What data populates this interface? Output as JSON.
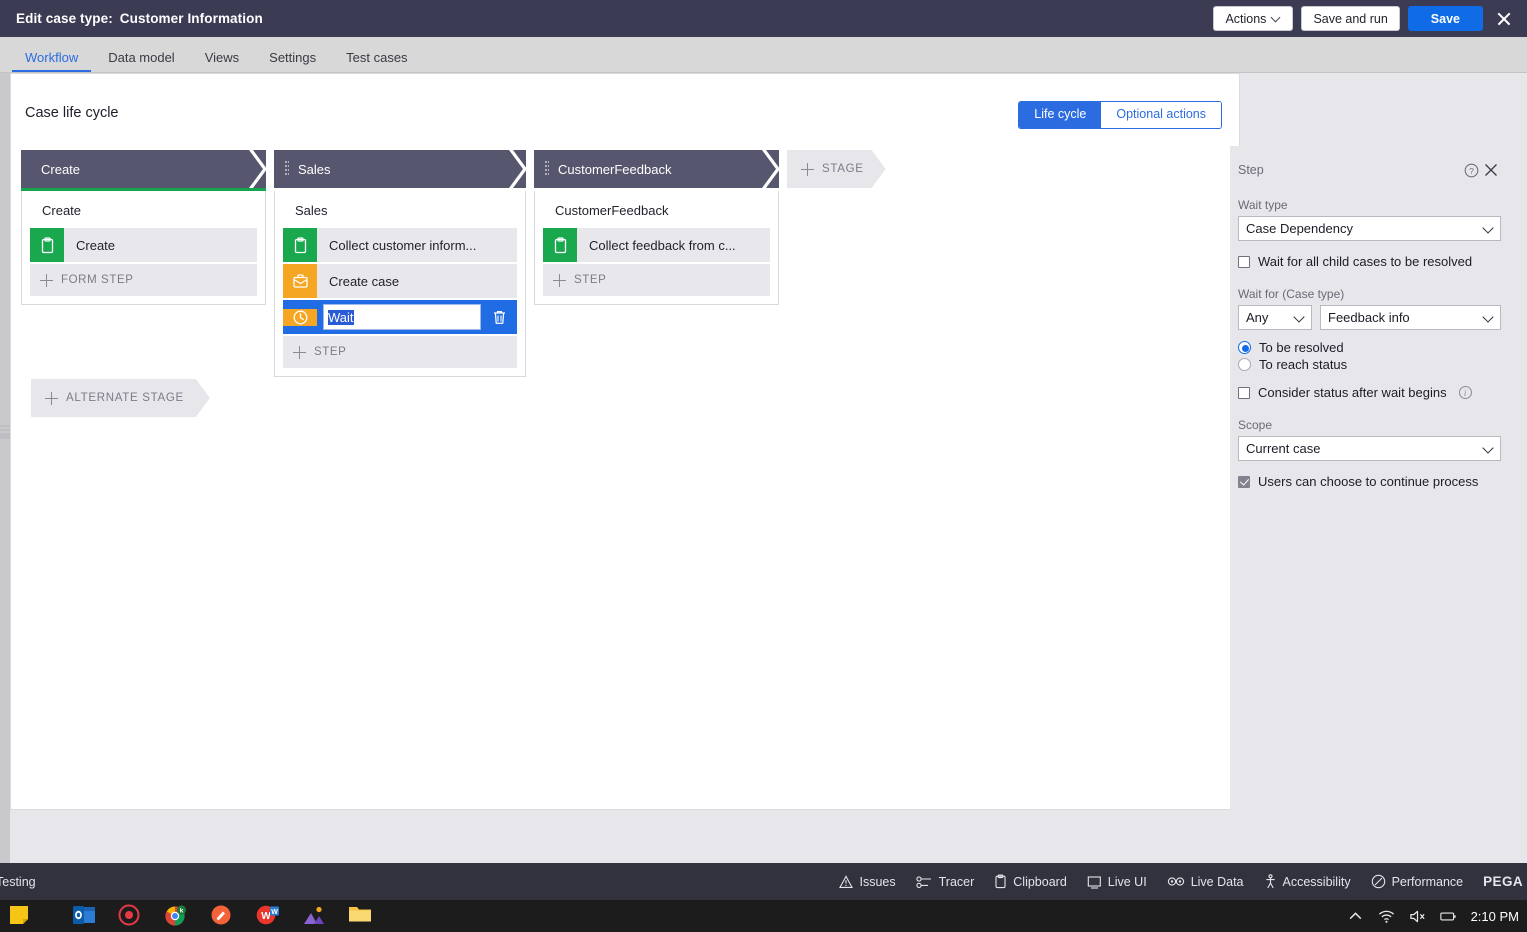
{
  "titlebar": {
    "label": "Edit case type:",
    "case_name": "Customer Information",
    "actions_button": "Actions",
    "save_and_run_button": "Save and run",
    "save_button": "Save",
    "close_icon": "close-icon"
  },
  "tabs": [
    {
      "label": "Workflow",
      "active": true
    },
    {
      "label": "Data model",
      "active": false
    },
    {
      "label": "Views",
      "active": false
    },
    {
      "label": "Settings",
      "active": false
    },
    {
      "label": "Test cases",
      "active": false
    }
  ],
  "canvas": {
    "title": "Case life cycle",
    "toggle": {
      "life_cycle": "Life cycle",
      "optional_actions": "Optional actions",
      "selected": "Life cycle"
    },
    "add_stage_label": "STAGE",
    "add_alternate_stage_label": "ALTERNATE STAGE"
  },
  "stages": [
    {
      "header": "Create",
      "name": "Create",
      "underline_color": "#16a44f",
      "has_grip": false,
      "steps": [
        {
          "label": "Create",
          "icon": "form-clipboard-icon",
          "icon_color": "#1aa84e",
          "editing": false
        }
      ],
      "add_step_label": "FORM STEP"
    },
    {
      "header": "Sales",
      "name": "Sales",
      "underline_color": "transparent",
      "has_grip": true,
      "steps": [
        {
          "label": "Collect customer inform...",
          "icon": "form-clipboard-icon",
          "icon_color": "#1aa84e",
          "editing": false
        },
        {
          "label": "Create case",
          "icon": "briefcase-icon",
          "icon_color": "#f5a623",
          "editing": false
        },
        {
          "label": "Wait",
          "icon": "clock-icon",
          "icon_color": "#f5a623",
          "editing": true,
          "delete_icon": "trash-icon"
        }
      ],
      "add_step_label": "STEP"
    },
    {
      "header": "CustomerFeedback",
      "name": "CustomerFeedback",
      "underline_color": "transparent",
      "has_grip": true,
      "steps": [
        {
          "label": "Collect feedback from c...",
          "icon": "form-clipboard-icon",
          "icon_color": "#1aa84e",
          "editing": false
        }
      ],
      "add_step_label": "STEP"
    }
  ],
  "properties_panel": {
    "title": "Step",
    "help_icon": "help-circle-icon",
    "close_icon": "close-icon",
    "wait_type_label": "Wait type",
    "wait_type_value": "Case Dependency",
    "wait_all_child_label": "Wait for all child cases to be resolved",
    "wait_all_child_checked": false,
    "wait_for_label": "Wait for (Case type)",
    "wait_for_qualifier_value": "Any",
    "wait_for_case_type_value": "Feedback info",
    "radio_to_be_resolved": "To be resolved",
    "radio_to_reach_status": "To reach status",
    "radio_selected": "To be resolved",
    "consider_status_label": "Consider status after wait begins",
    "consider_status_checked": false,
    "consider_status_info_icon": "info-icon",
    "scope_label": "Scope",
    "scope_value": "Current case",
    "users_continue_label": "Users can choose to continue process",
    "users_continue_checked": true
  },
  "status_bar": {
    "left_label": "Testing",
    "items": [
      {
        "label": "Issues",
        "icon": "warning-triangle-icon"
      },
      {
        "label": "Tracer",
        "icon": "tracer-icon"
      },
      {
        "label": "Clipboard",
        "icon": "clipboard-icon"
      },
      {
        "label": "Live UI",
        "icon": "live-ui-icon"
      },
      {
        "label": "Live Data",
        "icon": "live-data-icon"
      },
      {
        "label": "Accessibility",
        "icon": "accessibility-icon"
      },
      {
        "label": "Performance",
        "icon": "performance-icon"
      }
    ],
    "brand": "PEGA"
  },
  "taskbar": {
    "time": "2:10 PM",
    "tray_icons": [
      "chevron-up-icon",
      "wifi-icon",
      "speaker-muted-icon",
      "battery-icon"
    ],
    "app_icons": [
      "sticky-notes-icon",
      "outlook-icon",
      "record-icon",
      "chrome-icon",
      "paint-icon",
      "wps-icon",
      "photos-icon",
      "file-explorer-icon"
    ]
  }
}
